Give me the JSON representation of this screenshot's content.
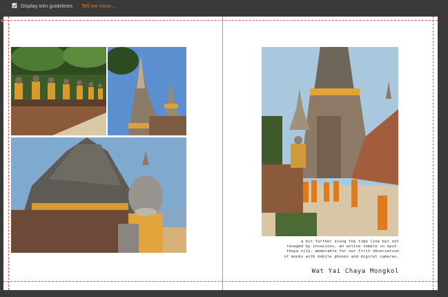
{
  "toolbar": {
    "checkbox_label": "Display trim guidelines",
    "checkbox_checked": true,
    "link_label": "Tell me more..."
  },
  "right_page": {
    "caption_lines": [
      "a bit further along the time line but not",
      "ravaged by invasions, an active temple in ayut-",
      "thaya city, memorable for our first observation",
      "of monks with mobile phones and digital cameras."
    ],
    "title": "Wat Yai Chaya Mongkol"
  },
  "colors": {
    "trim_guide": "#d9534f",
    "link": "#e07b1e",
    "workspace": "#3a3a3a"
  }
}
